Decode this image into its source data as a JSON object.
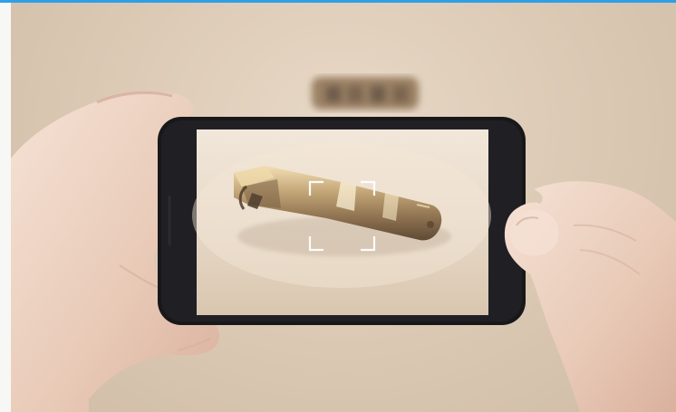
{
  "image": {
    "description_tags": [
      "phone-camera-preview",
      "brass-tool",
      "hands"
    ],
    "colors": {
      "accent_line": "#2f9fe6",
      "background": "#dcc8b2",
      "phone_body": "#1a1a1c",
      "screen_bg": "#e8dccb",
      "brass": "#b69a6f",
      "skin": "#efd7c7"
    },
    "icons": [
      "camera-focus-frame-icon"
    ]
  }
}
